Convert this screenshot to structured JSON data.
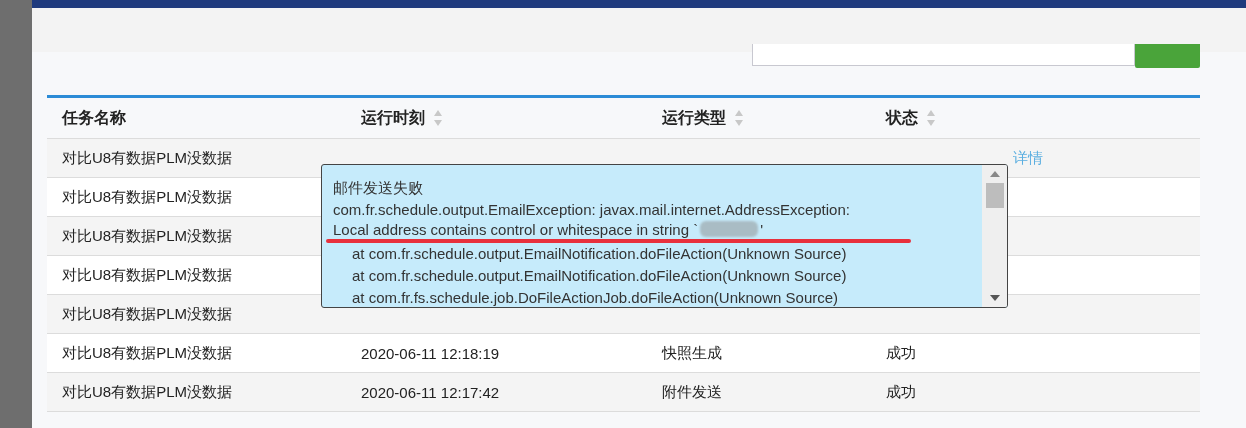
{
  "table": {
    "columns": [
      {
        "label": "任务名称",
        "sortable": false
      },
      {
        "label": "运行时刻",
        "sortable": true
      },
      {
        "label": "运行类型",
        "sortable": true
      },
      {
        "label": "状态",
        "sortable": true
      }
    ],
    "rows": [
      {
        "name": "对比U8有数据PLM没数据",
        "action": "详情"
      },
      {
        "name": "对比U8有数据PLM没数据"
      },
      {
        "name": "对比U8有数据PLM没数据"
      },
      {
        "name": "对比U8有数据PLM没数据"
      },
      {
        "name": "对比U8有数据PLM没数据"
      },
      {
        "name": "对比U8有数据PLM没数据",
        "time": "2020-06-11 12:18:19",
        "type": "快照生成",
        "status": "成功"
      },
      {
        "name": "对比U8有数据PLM没数据",
        "time": "2020-06-11 12:17:42",
        "type": "附件发送",
        "status": "成功"
      }
    ]
  },
  "tooltip": {
    "title": "邮件发送失败",
    "lines": [
      {
        "kind": "message",
        "text": "com.fr.schedule.output.EmailException: javax.mail.internet.AddressException:"
      },
      {
        "kind": "redacted",
        "text": "Local address contains control or whitespace in string `",
        "tail": "'"
      },
      {
        "kind": "trace",
        "text": "at com.fr.schedule.output.EmailNotification.doFileAction(Unknown Source)"
      },
      {
        "kind": "trace",
        "text": "at com.fr.schedule.output.EmailNotification.doFileAction(Unknown Source)"
      },
      {
        "kind": "trace",
        "text": "at com.fr.fs.schedule.job.DoFileActionJob.doFileAction(Unknown Source)"
      }
    ]
  }
}
